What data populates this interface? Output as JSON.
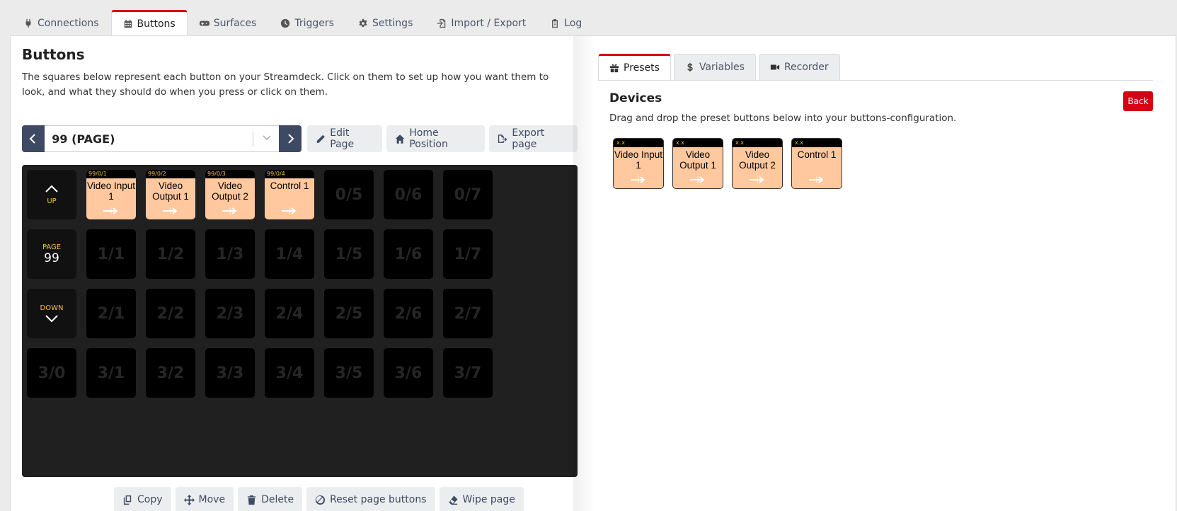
{
  "nav_tabs": [
    {
      "label": "Connections",
      "icon": "plug-icon"
    },
    {
      "label": "Buttons",
      "icon": "calendar-grid-icon"
    },
    {
      "label": "Surfaces",
      "icon": "gamepad-icon"
    },
    {
      "label": "Triggers",
      "icon": "clock-icon"
    },
    {
      "label": "Settings",
      "icon": "gear-icon"
    },
    {
      "label": "Import / Export",
      "icon": "file-import-icon"
    },
    {
      "label": "Log",
      "icon": "clipboard-icon"
    }
  ],
  "buttons": {
    "title": "Buttons",
    "description": "The squares below represent each button on your Streamdeck. Click on them to set up how you want them to look, and what they should do when you press or click on them.",
    "page_select": "99 (PAGE)",
    "edit_page": "Edit Page",
    "home_position": "Home Position",
    "export_page": "Export page",
    "up_label": "UP",
    "page_label": "PAGE",
    "page_number": "99",
    "down_label": "DOWN",
    "presets": [
      {
        "bar": "99/0/1",
        "text": "Video Input 1"
      },
      {
        "bar": "99/0/2",
        "text": "Video Output 1"
      },
      {
        "bar": "99/0/3",
        "text": "Video Output 2"
      },
      {
        "bar": "99/0/4",
        "text": "Control 1"
      }
    ],
    "row0_empty": [
      "0/5",
      "0/6",
      "0/7"
    ],
    "row1": [
      "1/1",
      "1/2",
      "1/3",
      "1/4",
      "1/5",
      "1/6",
      "1/7"
    ],
    "row2": [
      "2/1",
      "2/2",
      "2/3",
      "2/4",
      "2/5",
      "2/6",
      "2/7"
    ],
    "row3": [
      "3/0",
      "3/1",
      "3/2",
      "3/3",
      "3/4",
      "3/5",
      "3/6",
      "3/7"
    ],
    "copy": "Copy",
    "move": "Move",
    "delete": "Delete",
    "reset": "Reset page buttons",
    "wipe": "Wipe page"
  },
  "right": {
    "tabs": [
      "Presets",
      "Variables",
      "Recorder"
    ],
    "title": "Devices",
    "back": "Back",
    "description": "Drag and drop the preset buttons below into your buttons-configuration.",
    "presets": [
      {
        "bar": "x.x",
        "text": "Video Input 1"
      },
      {
        "bar": "x.x",
        "text": "Video Output 1"
      },
      {
        "bar": "x.x",
        "text": "Video Output 2"
      },
      {
        "bar": "x.x",
        "text": "Control 1"
      }
    ]
  },
  "colors": {
    "accent": "#d50215",
    "preset_bg": "#ffc89e",
    "nav_btn": "#3e4a64"
  }
}
